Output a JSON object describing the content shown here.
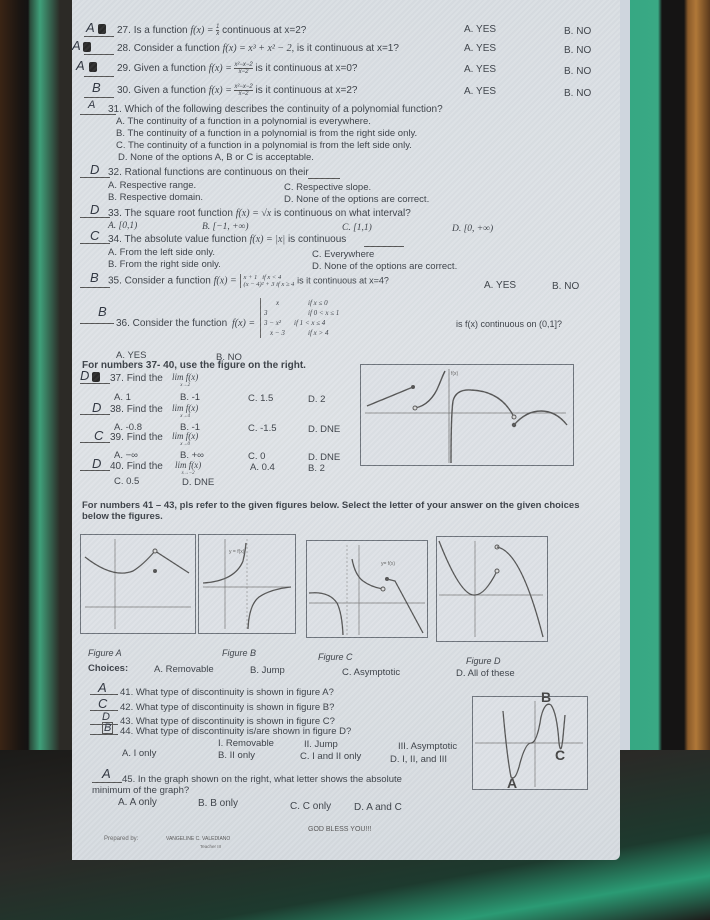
{
  "questions_part1": [
    {
      "answer": "A",
      "number": "27.",
      "text_pre": "Is a function",
      "math": "f(x) = ",
      "frac_num": "1",
      "frac_den": "x",
      "text_post": "continuous at x=2?",
      "opt_a": "A. YES",
      "opt_b": "B. NO"
    },
    {
      "answer": "A",
      "number": "28.",
      "text_pre": "Consider a function",
      "math": "f(x) = x³ + x² − 2,",
      "text_post": "is it continuous at x=1?",
      "opt_a": "A. YES",
      "opt_b": "B. NO"
    },
    {
      "answer": "A",
      "number": "29.",
      "text_pre": "Given a function",
      "math": "f(x) = ",
      "frac_num": "x²−x−2",
      "frac_den": "x−2",
      "text_post": "is it continuous at x=0?",
      "opt_a": "A. YES",
      "opt_b": "B. NO"
    },
    {
      "answer": "B",
      "number": "30.",
      "text_pre": "Given a function",
      "math": "f(x) = ",
      "frac_num": "x²−x−2",
      "frac_den": "x−2",
      "text_post": "is it continuous at x=2?",
      "opt_a": "A. YES",
      "opt_b": "B. NO"
    }
  ],
  "q31": {
    "answer": "A",
    "text": "31. Which of the following describes the continuity of a polynomial function?",
    "options": [
      "A.  The continuity of a function in a polynomial is everywhere.",
      "B.  The continuity of a function in a polynomial is from the right side only.",
      "C.  The continuity of a function in a polynomial is from the left side only.",
      "D.  None of the options A, B or C is acceptable."
    ]
  },
  "q32": {
    "answer": "D",
    "text": "32. Rational functions are continuous on their",
    "options": [
      "A.  Respective range.",
      "B.  Respective domain.",
      "C. Respective slope.",
      "D. None of the options are correct."
    ]
  },
  "q33": {
    "answer": "D",
    "text_pre": "33. The square root function",
    "math": "f(x) = √x",
    "text_post": "is continuous on what interval?",
    "options": [
      "A.  [0,1)",
      "B. [−1, +∞)",
      "C. [1,1)",
      "D. [0, +∞)"
    ]
  },
  "q34": {
    "answer": "C",
    "text_pre": "34. The absolute value function",
    "math": "f(x) = |x|",
    "text_post": "is continuous",
    "options": [
      "A.  From the left side only.",
      "B.  From the right side only.",
      "C. Everywhere",
      "D. None of the options are correct."
    ]
  },
  "q35": {
    "answer": "B",
    "text_pre": "35. Consider a function",
    "math": "f(x) =",
    "pieces": [
      {
        "expr": "x + 1",
        "cond": "if x < 4"
      },
      {
        "expr": "(x − 4)² + 3",
        "cond": "if x ≥ 4"
      }
    ],
    "text_post": "is it continuous at x=4?",
    "opt_a": "A. YES",
    "opt_b": "B. NO"
  },
  "q36": {
    "answer": "B",
    "text_pre": "36. Consider the function",
    "math": "f(x) =",
    "pieces": [
      {
        "expr": "x",
        "cond": "if x ≤ 0"
      },
      {
        "expr": "3",
        "cond": "if 0 < x ≤ 1"
      },
      {
        "expr": "3 − x²",
        "cond": "if 1 < x ≤ 4"
      },
      {
        "expr": "x − 3",
        "cond": "if x > 4"
      }
    ],
    "text_post": "is f(x) continuous on (0,1]?",
    "opt_a": "A.  YES",
    "opt_b": "B. NO"
  },
  "section_37_40": {
    "heading": "For numbers 37- 40, use the figure on the right.",
    "graph_label": "f(x)",
    "questions": [
      {
        "answer": "D",
        "number": "37.",
        "text": "Find the",
        "limit": "lim f(x)",
        "approach": "x→2",
        "options": [
          "A. 1",
          "B. -1",
          "C. 1.5",
          "D. 2"
        ]
      },
      {
        "answer": "D",
        "number": "38.",
        "text": "Find the",
        "limit": "lim f(x)",
        "approach": "x→4",
        "options": [
          "A. -0.8",
          "B. -1",
          "C. -1.5",
          "D. DNE"
        ]
      },
      {
        "answer": "C",
        "number": "39.",
        "text": "Find the",
        "limit": "lim f(x)",
        "approach": "x→0",
        "options": [
          "A. −∞",
          "B. +∞",
          "C. 0",
          "D. DNE"
        ]
      },
      {
        "answer": "D",
        "number": "40.",
        "text": "Find the",
        "limit": "lim f(x)",
        "approach": "x→−2",
        "options": [
          "A. 0.4",
          "B. 2",
          "C. 0.5",
          "D. DNE"
        ]
      }
    ]
  },
  "section_41_43": {
    "heading": "For numbers 41 – 43, pls refer to the given figures below. Select the letter of your answer on the given choices below the figures.",
    "figures": [
      "Figure A",
      "Figure B",
      "Figure C",
      "Figure D"
    ],
    "figure_b_label": "y = f(x)",
    "figure_c_label": "y= f(x)",
    "choices_label": "Choices:",
    "choices": [
      "A.  Removable",
      "B. Jump",
      "C. Asymptotic",
      "D. All of these"
    ],
    "questions": [
      {
        "answer": "A",
        "text": "41.  What type of discontinuity is shown in figure A?"
      },
      {
        "answer": "C",
        "text": "42.  What type of discontinuity is shown in figure B?"
      },
      {
        "answer": "D",
        "text": "43.  What type of discontinuity is shown in figure C?"
      },
      {
        "answer": "B",
        "text": "44.  What type of discontinuity is/are shown in figure D?"
      }
    ],
    "q44_types": [
      "I.  Removable",
      "II. Jump",
      "III. Asymptotic"
    ],
    "q44_options": [
      "A. I only",
      "B. II only",
      "C. I and II only",
      "D. I, II, and III"
    ]
  },
  "q45": {
    "answer": "A",
    "text": "45. In the graph shown on the right, what letter shows the absolute",
    "text2": "minimum of the graph?",
    "options": [
      "A.  A only",
      "B.  B only",
      "C. C only",
      "D. A and C"
    ],
    "graph_points": [
      "A",
      "B",
      "C"
    ]
  },
  "footer": {
    "closing": "GOD BLESS YOU!!!",
    "prepared_by": "Prepared by:",
    "name": "VANGELINE C. VALEDIANO",
    "role": "Teacher III"
  }
}
